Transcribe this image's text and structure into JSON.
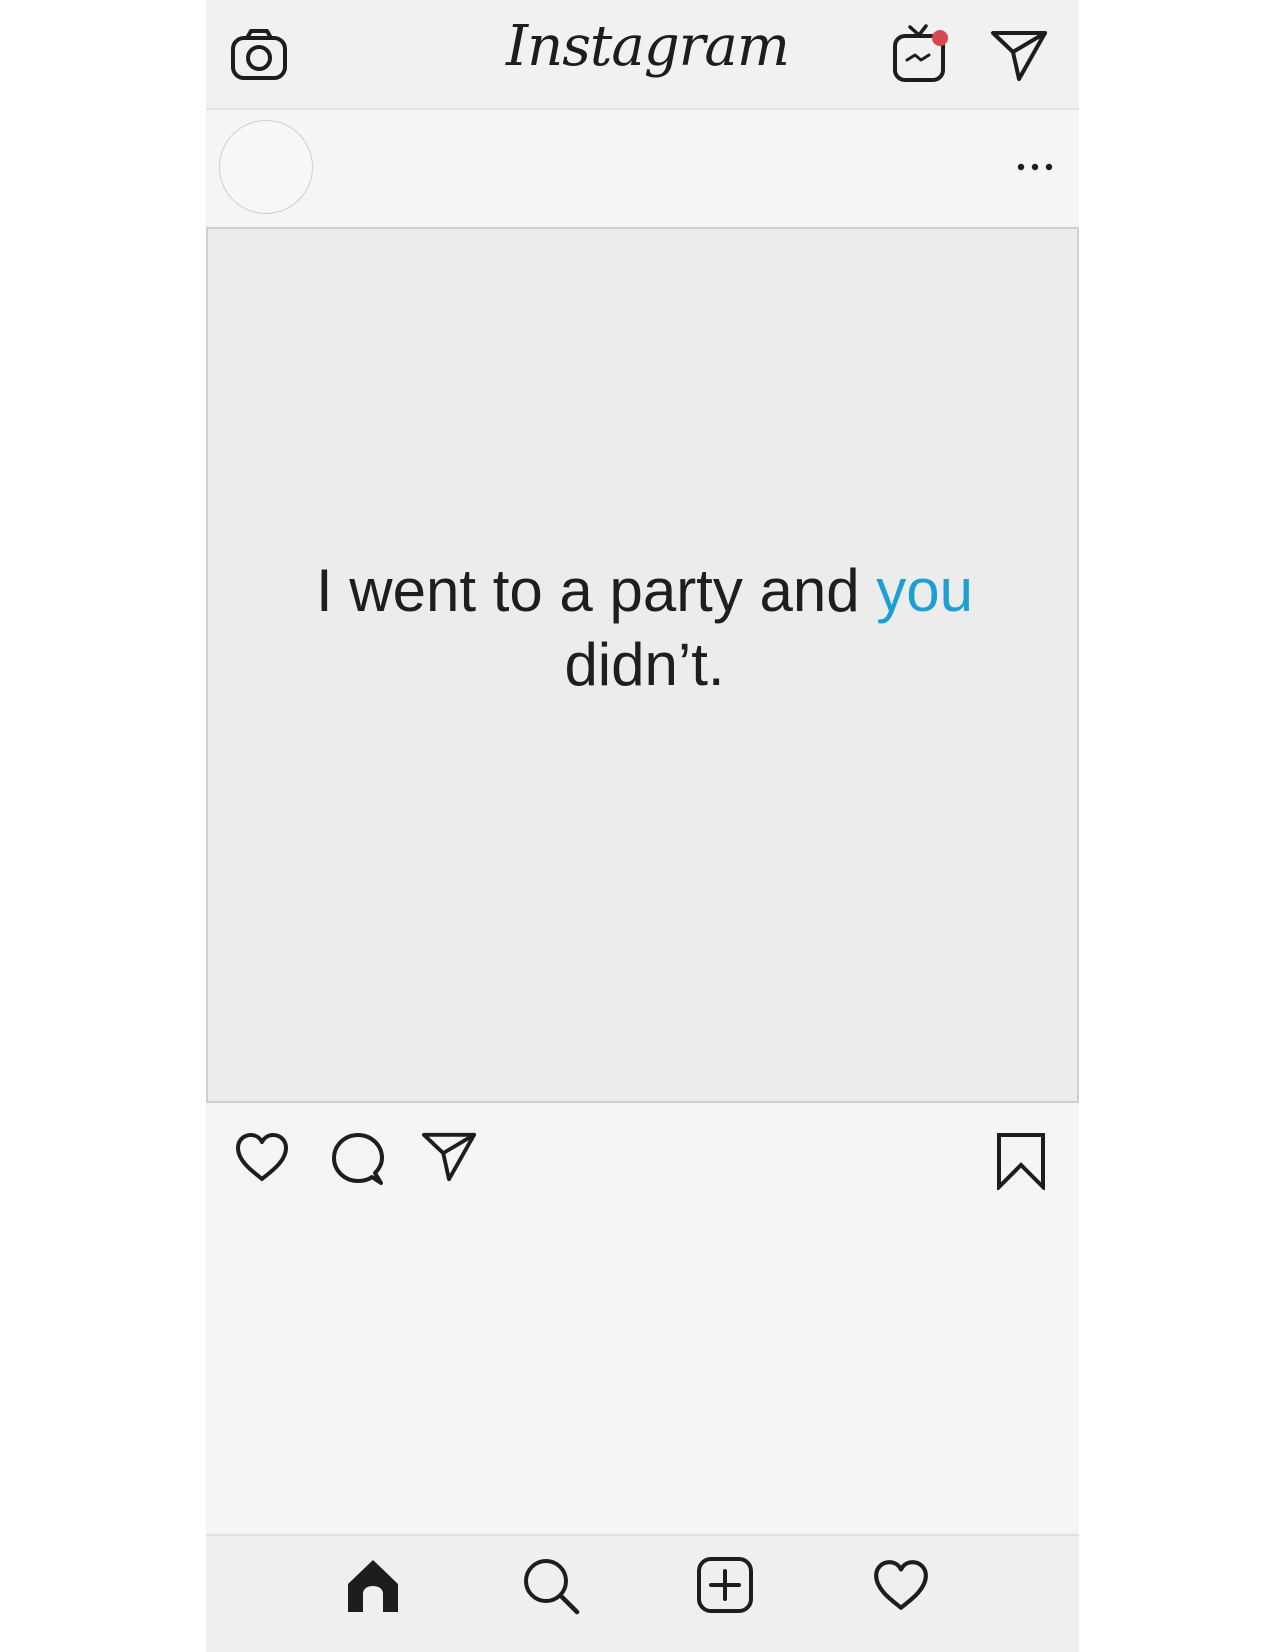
{
  "app": {
    "logo_text": "Instagram"
  },
  "topbar": {
    "camera_icon": "camera-icon",
    "igtv_icon": "igtv-icon",
    "igtv_badge_color": "#d9484f",
    "direct_icon": "paper-plane-icon"
  },
  "post": {
    "more_icon": "more-dots-icon",
    "caption_part1": "I went to a party and ",
    "caption_accent": "you",
    "caption_part2": "didn’t.",
    "accent_color": "#1e9fd3"
  },
  "post_actions": {
    "like_icon": "heart-icon",
    "comment_icon": "comment-icon",
    "share_icon": "paper-plane-icon",
    "save_icon": "bookmark-icon"
  },
  "bottom_nav": {
    "items": [
      "home-icon",
      "search-icon",
      "add-post-icon",
      "activity-heart-icon"
    ]
  }
}
